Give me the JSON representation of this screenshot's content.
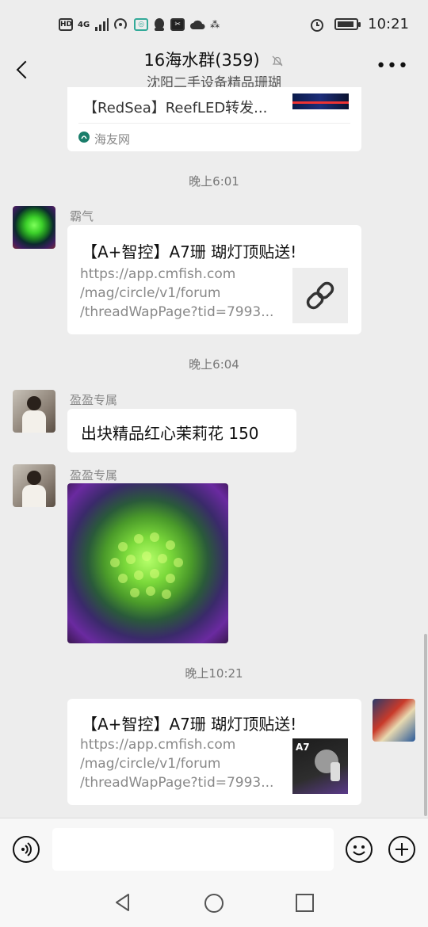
{
  "status": {
    "left_icons": [
      "HD",
      "4G",
      "signal-icon",
      "hotspot-icon",
      "app-icon",
      "qq-icon",
      "capcut-icon",
      "cloud-icon",
      "vpn-icon"
    ],
    "hd": "HD",
    "net": "4G",
    "time": "10:21"
  },
  "header": {
    "title": "16海水群(359)",
    "subtitle": "沈阳二手设备精品珊瑚"
  },
  "messages": {
    "top_card": {
      "title": "【RedSea】ReefLED转发...",
      "source": "海友网"
    },
    "time1": "晚上6:01",
    "msg1": {
      "sender": "霸气",
      "title": "【A+智控】A7珊 瑚灯顶贴送!",
      "url_lines": [
        "https://app.cmfish.com",
        "/mag/circle/v1/forum",
        "/threadWapPage?tid=7993..."
      ]
    },
    "time2": "晚上6:04",
    "msg2": {
      "sender": "盈盈专属",
      "text": "出块精品红心茉莉花  150"
    },
    "msg3": {
      "sender": "盈盈专属"
    },
    "time3": "晚上10:21",
    "msg4": {
      "title": "【A+智控】A7珊 瑚灯顶贴送!",
      "url_lines": [
        "https://app.cmfish.com",
        "/mag/circle/v1/forum",
        "/threadWapPage?tid=7993..."
      ],
      "thumb_label": "A7"
    }
  },
  "colors": {
    "background": "#ededed",
    "card": "#ffffff",
    "secondary_text": "#888888"
  }
}
